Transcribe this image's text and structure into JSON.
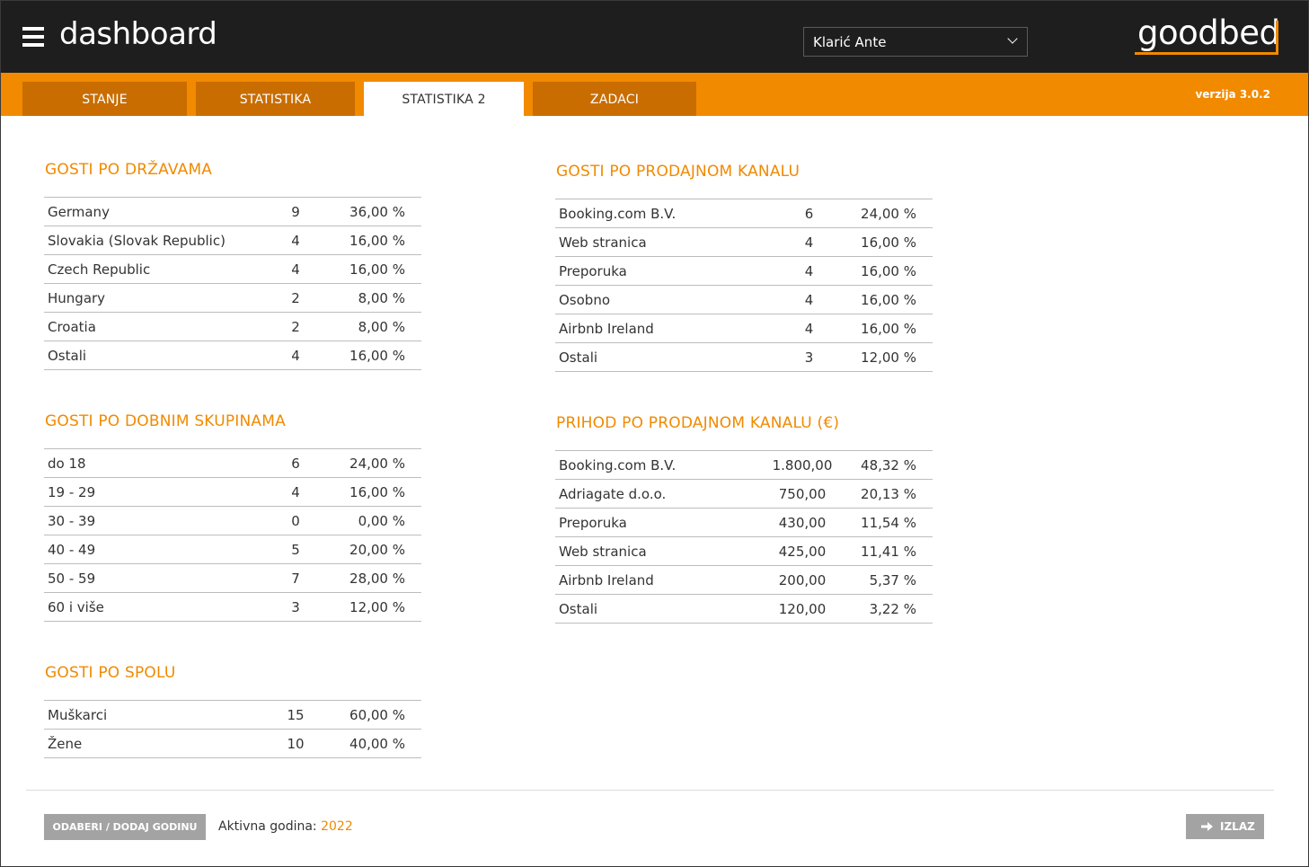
{
  "header": {
    "title": "dashboard",
    "user_selected": "Klarić Ante",
    "logo_text": "goodbed"
  },
  "tabs": [
    {
      "label": "STANJE"
    },
    {
      "label": "STATISTIKA"
    },
    {
      "label": "STATISTIKA 2"
    },
    {
      "label": "ZADACI"
    }
  ],
  "version": "verzija 3.0.2",
  "sections": {
    "countries": {
      "title": "GOSTI PO DRŽAVAMA",
      "rows": [
        {
          "label": "Germany",
          "count": "9",
          "pct": "36,00 %"
        },
        {
          "label": "Slovakia (Slovak Republic)",
          "count": "4",
          "pct": "16,00 %"
        },
        {
          "label": "Czech Republic",
          "count": "4",
          "pct": "16,00 %"
        },
        {
          "label": "Hungary",
          "count": "2",
          "pct": "8,00 %"
        },
        {
          "label": "Croatia",
          "count": "2",
          "pct": "8,00 %"
        },
        {
          "label": "Ostali",
          "count": "4",
          "pct": "16,00 %"
        }
      ]
    },
    "age": {
      "title": "GOSTI PO DOBNIM SKUPINAMA",
      "rows": [
        {
          "label": "do 18",
          "count": "6",
          "pct": "24,00 %"
        },
        {
          "label": "19 - 29",
          "count": "4",
          "pct": "16,00 %"
        },
        {
          "label": "30 - 39",
          "count": "0",
          "pct": "0,00 %"
        },
        {
          "label": "40 - 49",
          "count": "5",
          "pct": "20,00 %"
        },
        {
          "label": "50 - 59",
          "count": "7",
          "pct": "28,00 %"
        },
        {
          "label": "60 i više",
          "count": "3",
          "pct": "12,00 %"
        }
      ]
    },
    "gender": {
      "title": "GOSTI PO SPOLU",
      "rows": [
        {
          "label": "Muškarci",
          "count": "15",
          "pct": "60,00 %"
        },
        {
          "label": "Žene",
          "count": "10",
          "pct": "40,00 %"
        }
      ]
    },
    "channels": {
      "title": "GOSTI PO PRODAJNOM KANALU",
      "rows": [
        {
          "label": "Booking.com B.V.",
          "count": "6",
          "pct": "24,00 %"
        },
        {
          "label": "Web stranica",
          "count": "4",
          "pct": "16,00 %"
        },
        {
          "label": "Preporuka",
          "count": "4",
          "pct": "16,00 %"
        },
        {
          "label": "Osobno",
          "count": "4",
          "pct": "16,00 %"
        },
        {
          "label": "Airbnb Ireland",
          "count": "4",
          "pct": "16,00 %"
        },
        {
          "label": "Ostali",
          "count": "3",
          "pct": "12,00 %"
        }
      ]
    },
    "revenue": {
      "title": "PRIHOD PO PRODAJNOM KANALU (€)",
      "rows": [
        {
          "label": "Booking.com B.V.",
          "count": "1.800,00",
          "pct": "48,32 %"
        },
        {
          "label": "Adriagate d.o.o.",
          "count": "750,00",
          "pct": "20,13 %"
        },
        {
          "label": "Preporuka",
          "count": "430,00",
          "pct": "11,54 %"
        },
        {
          "label": "Web stranica",
          "count": "425,00",
          "pct": "11,41 %"
        },
        {
          "label": "Airbnb Ireland",
          "count": "200,00",
          "pct": "5,37 %"
        },
        {
          "label": "Ostali",
          "count": "120,00",
          "pct": "3,22 %"
        }
      ]
    }
  },
  "footer": {
    "select_year_button": "ODABERI / DODAJ GODINU",
    "active_year_label": "Aktivna godina:",
    "active_year": "2022",
    "exit_button": "IZLAZ"
  },
  "colors": {
    "accent": "#f28a00",
    "header_bg": "#1e1e1e",
    "tab_bg": "#c96d00",
    "button_gray": "#a3a3a3"
  },
  "icons": {
    "menu": "hamburger-icon",
    "dropdown": "chevron-down-icon",
    "exit": "arrow-right-icon"
  }
}
